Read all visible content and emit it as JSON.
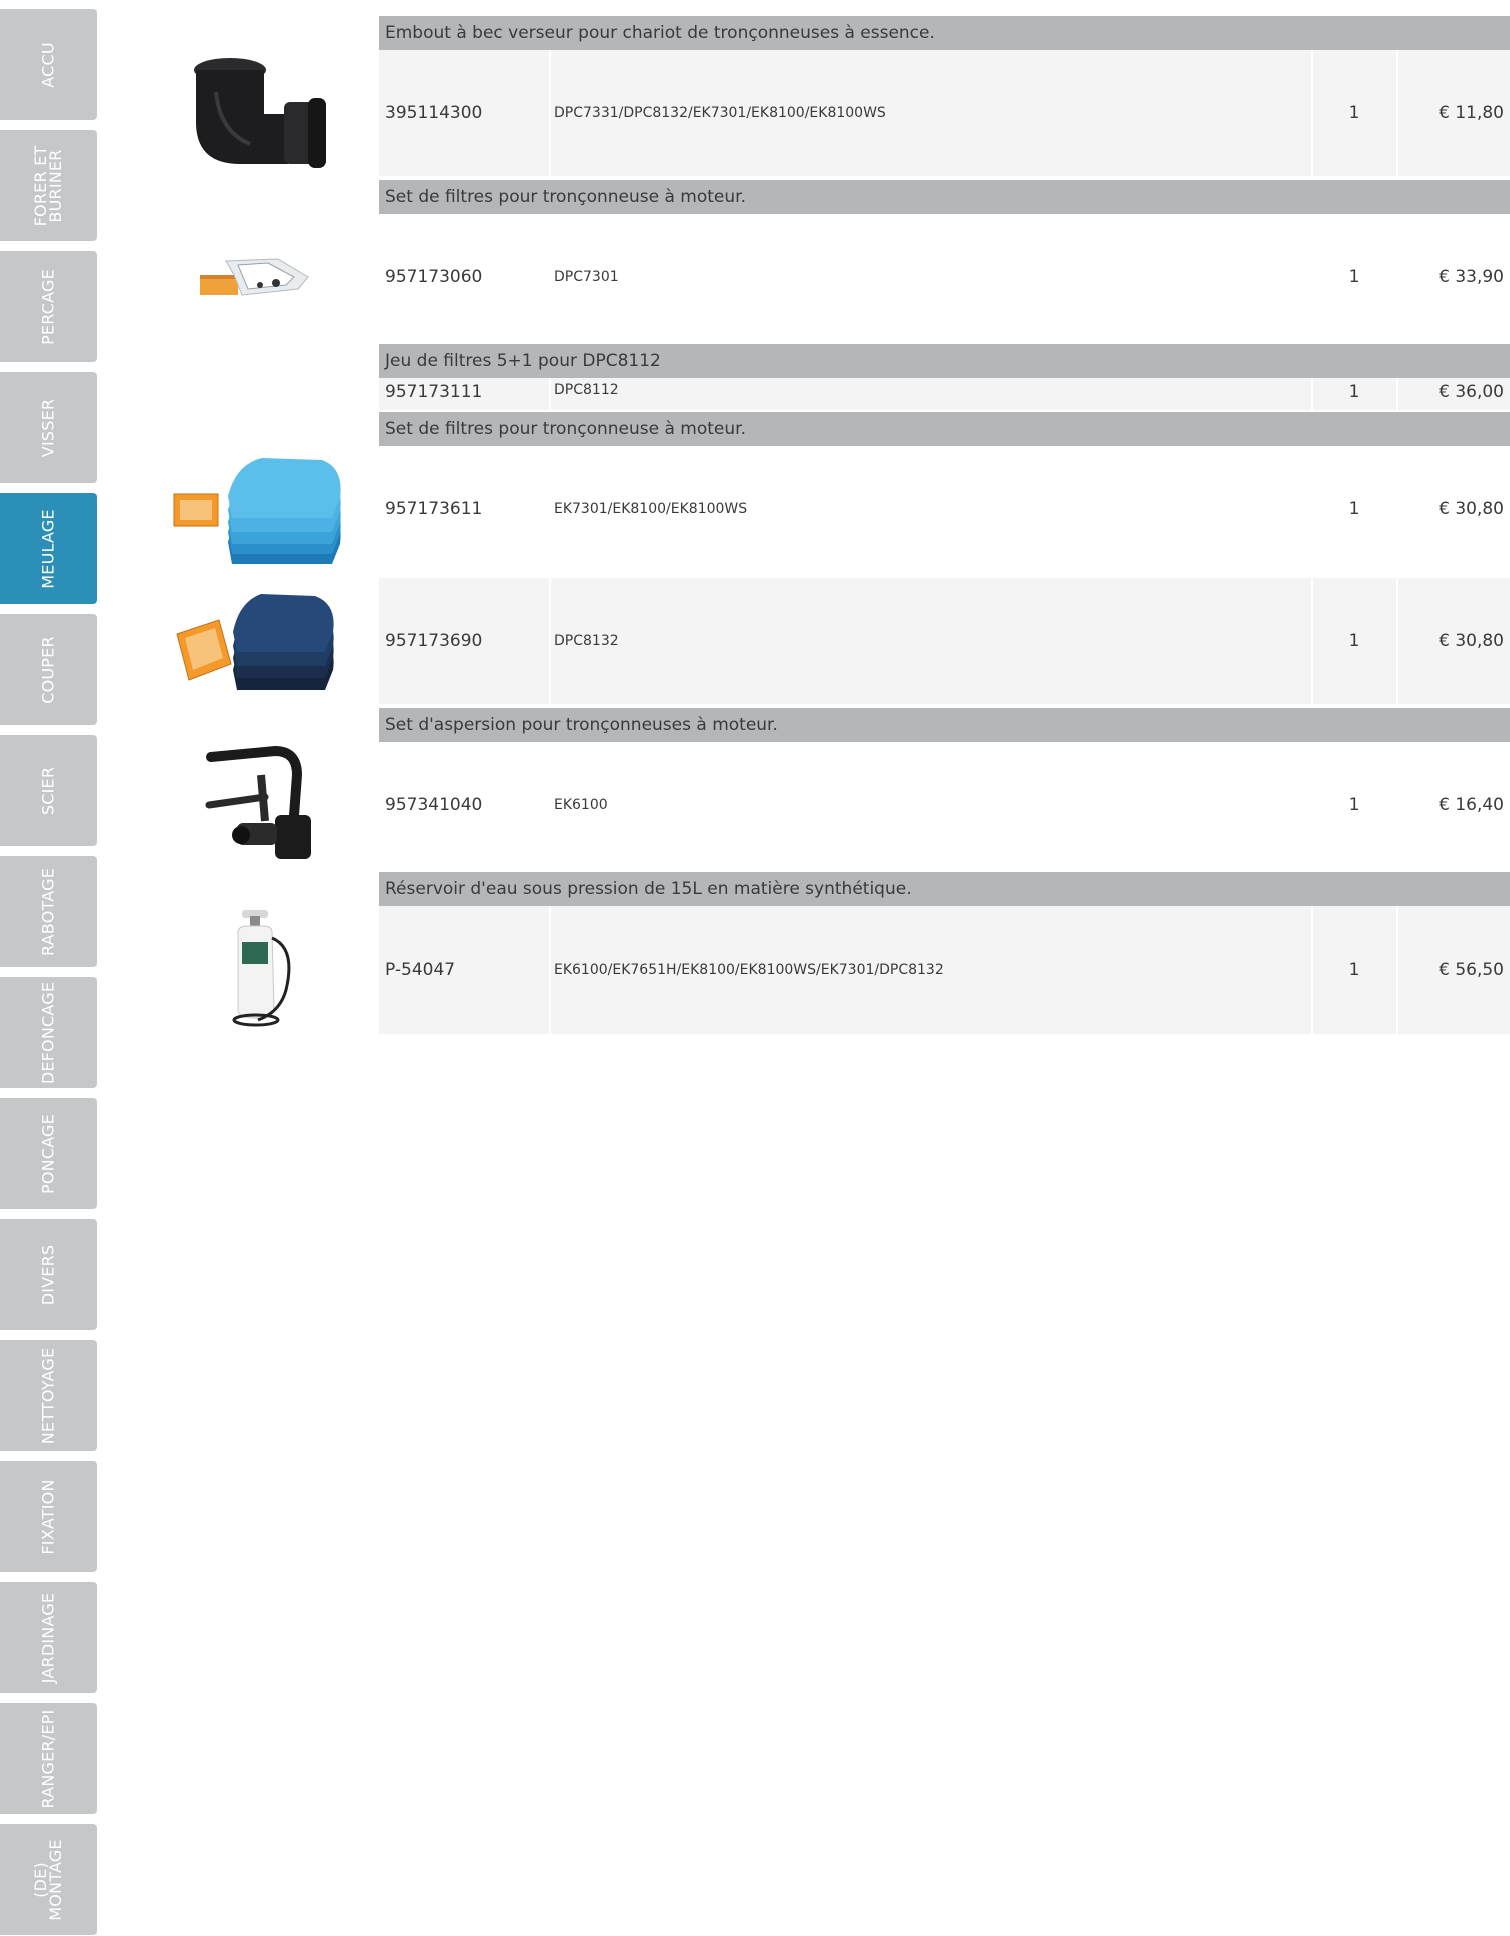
{
  "tabs": [
    {
      "label": "ACCU",
      "active": false
    },
    {
      "label": "FORER ET\nBURINER",
      "active": false
    },
    {
      "label": "PERCAGE",
      "active": false
    },
    {
      "label": "VISSER",
      "active": false
    },
    {
      "label": "MEULAGE",
      "active": true
    },
    {
      "label": "COUPER",
      "active": false
    },
    {
      "label": "SCIER",
      "active": false
    },
    {
      "label": "RABOTAGE",
      "active": false
    },
    {
      "label": "DEFONCAGE",
      "active": false
    },
    {
      "label": "PONCAGE",
      "active": false
    },
    {
      "label": "DIVERS",
      "active": false
    },
    {
      "label": "NETTOYAGE",
      "active": false
    },
    {
      "label": "FIXATION",
      "active": false
    },
    {
      "label": "JARDINAGE",
      "active": false
    },
    {
      "label": "RANGER/EPI",
      "active": false
    },
    {
      "label": "(DE)\nMONTAGE",
      "active": false
    }
  ],
  "groups": [
    {
      "header": "Embout à bec verseur pour chariot de tronçonneuses à essence."
    },
    {
      "header": "Set de filtres pour tronçonneuse à moteur."
    },
    {
      "header": "Jeu de filtres 5+1 pour DPC8112"
    },
    {
      "header": "Set de filtres pour tronçonneuse à moteur."
    },
    {
      "header": "Set d'aspersion pour tronçonneuses à moteur."
    },
    {
      "header": "Réservoir d'eau sous pression de 15L en matière synthétique."
    }
  ],
  "products": [
    {
      "ref": "395114300",
      "models": "DPC7331/DPC8132/EK7301/EK8100/EK8100WS",
      "qty": "1",
      "price": "€ 11,80"
    },
    {
      "ref": "957173060",
      "models": "DPC7301",
      "qty": "1",
      "price": "€ 33,90"
    },
    {
      "ref": "957173111",
      "models": "DPC8112",
      "qty": "1",
      "price": "€ 36,00"
    },
    {
      "ref": "957173611",
      "models": "EK7301/EK8100/EK8100WS",
      "qty": "1",
      "price": "€ 30,80"
    },
    {
      "ref": "957173690",
      "models": "DPC8132",
      "qty": "1",
      "price": "€ 30,80"
    },
    {
      "ref": "957341040",
      "models": "EK6100",
      "qty": "1",
      "price": "€ 16,40"
    },
    {
      "ref": "P-54047",
      "models": "EK6100/EK7651H/EK8100/EK8100WS/EK7301/DPC8132",
      "qty": "1",
      "price": "€ 56,50"
    }
  ],
  "images": [
    {
      "icon": "elbow-spout-icon",
      "colors": {
        "body": "#1d1d1f"
      }
    },
    {
      "icon": "filter-set-icon",
      "colors": {
        "filter": "#f0a23a",
        "sheet": "#e9ecef"
      }
    },
    {
      "icon": "blue-filter-stack-icon",
      "colors": {
        "foam": "#3aa3d8",
        "filter": "#f39a2b"
      }
    },
    {
      "icon": "dark-blue-filter-stack-icon",
      "colors": {
        "foam": "#1f3c63",
        "filter": "#f39a2b"
      }
    },
    {
      "icon": "sprinkler-set-icon",
      "colors": {
        "body": "#1b1b1b"
      }
    },
    {
      "icon": "pressure-tank-icon",
      "colors": {
        "tank": "#f2f3f2",
        "hose": "#222222"
      }
    }
  ]
}
